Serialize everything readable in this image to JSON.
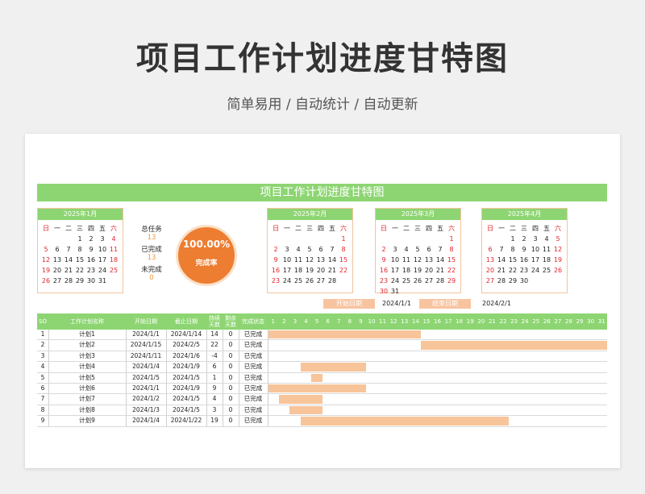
{
  "hero": {
    "title": "项目工作计划进度甘特图",
    "subtitle": "简单易用  /  自动统计  /  自动更新"
  },
  "sheet": {
    "banner": "项目工作计划进度甘特图",
    "weekdays": [
      "日",
      "一",
      "二",
      "三",
      "四",
      "五",
      "六"
    ],
    "calendars": [
      {
        "title": "2025年1月",
        "lead": 3,
        "days": 31
      },
      {
        "title": "2025年2月",
        "lead": 6,
        "days": 28
      },
      {
        "title": "2025年3月",
        "lead": 6,
        "days": 31
      },
      {
        "title": "2025年4月",
        "lead": 2,
        "days": 30
      }
    ],
    "stats": {
      "total_label": "总任务",
      "total_value": "13",
      "done_label": "已完成",
      "done_value": "13",
      "pending_label": "未完成",
      "pending_value": "0"
    },
    "completion": {
      "percent": "100.00%",
      "label": "完成率"
    },
    "dates": {
      "start_label": "开始日期",
      "start_value": "2024/1/1",
      "end_label": "结束日期",
      "end_value": "2024/2/1"
    },
    "table": {
      "headers": {
        "no": "SO",
        "name": "工作计划名称",
        "start": "开始日期",
        "end": "截止日期",
        "duration": "持续天数",
        "remaining": "剩余天数",
        "status": "完成状态"
      },
      "day_labels": [
        "1",
        "2",
        "3",
        "4",
        "5",
        "6",
        "7",
        "8",
        "9",
        "10",
        "11",
        "12",
        "13",
        "14",
        "15",
        "16",
        "17",
        "18",
        "19",
        "20",
        "21",
        "22",
        "23",
        "24",
        "25",
        "26",
        "27",
        "28",
        "29",
        "30",
        "31"
      ],
      "rows": [
        {
          "no": "1",
          "name": "计划1",
          "start": "2024/1/1",
          "end": "2024/1/14",
          "duration": "14",
          "remaining": "0",
          "status": "已完成",
          "bar_start": 1,
          "bar_end": 14
        },
        {
          "no": "2",
          "name": "计划2",
          "start": "2024/1/15",
          "end": "2024/2/5",
          "duration": "22",
          "remaining": "0",
          "status": "已完成",
          "bar_start": 15,
          "bar_end": 31
        },
        {
          "no": "3",
          "name": "计划3",
          "start": "2024/1/11",
          "end": "2024/1/6",
          "duration": "-4",
          "remaining": "0",
          "status": "已完成",
          "bar_start": 0,
          "bar_end": 0
        },
        {
          "no": "4",
          "name": "计划4",
          "start": "2024/1/4",
          "end": "2024/1/9",
          "duration": "6",
          "remaining": "0",
          "status": "已完成",
          "bar_start": 4,
          "bar_end": 9
        },
        {
          "no": "5",
          "name": "计划5",
          "start": "2024/1/5",
          "end": "2024/1/5",
          "duration": "1",
          "remaining": "0",
          "status": "已完成",
          "bar_start": 5,
          "bar_end": 5
        },
        {
          "no": "6",
          "name": "计划6",
          "start": "2024/1/1",
          "end": "2024/1/9",
          "duration": "9",
          "remaining": "0",
          "status": "已完成",
          "bar_start": 1,
          "bar_end": 9
        },
        {
          "no": "7",
          "name": "计划7",
          "start": "2024/1/2",
          "end": "2024/1/5",
          "duration": "4",
          "remaining": "0",
          "status": "已完成",
          "bar_start": 2,
          "bar_end": 5
        },
        {
          "no": "8",
          "name": "计划8",
          "start": "2024/1/3",
          "end": "2024/1/5",
          "duration": "3",
          "remaining": "0",
          "status": "已完成",
          "bar_start": 3,
          "bar_end": 5
        },
        {
          "no": "9",
          "name": "计划9",
          "start": "2024/1/4",
          "end": "2024/1/22",
          "duration": "19",
          "remaining": "0",
          "status": "已完成",
          "bar_start": 4,
          "bar_end": 22
        }
      ]
    },
    "colors": {
      "green": "#8dd572",
      "orange": "#ed7d31",
      "bar": "#f8c49a",
      "red": "#e0242b"
    }
  }
}
